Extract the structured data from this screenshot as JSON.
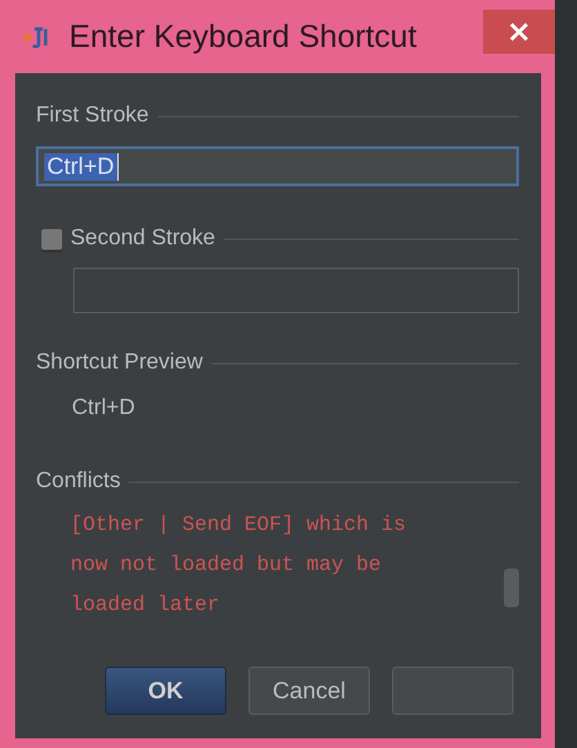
{
  "window": {
    "title": "Enter Keyboard Shortcut",
    "close": "×"
  },
  "first_stroke": {
    "label": "First Stroke",
    "value": "Ctrl+D"
  },
  "second_stroke": {
    "label": "Second Stroke",
    "checked": false
  },
  "preview": {
    "label": "Shortcut Preview",
    "value": "Ctrl+D"
  },
  "conflicts": {
    "label": "Conflicts",
    "lines": [
      "[Other | Send EOF] which is",
      "now not loaded but may be",
      "loaded later"
    ]
  },
  "buttons": [
    {
      "label": "OK",
      "kind": "default"
    },
    {
      "label": "Cancel",
      "kind": "normal"
    },
    {
      "kind": "normal"
    }
  ]
}
